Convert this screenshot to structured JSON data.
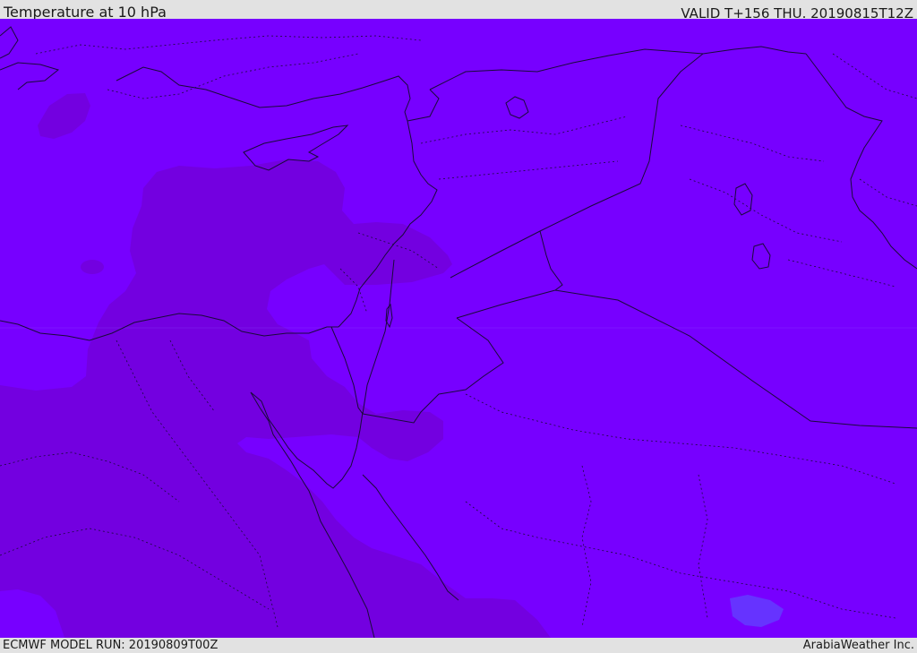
{
  "header": {
    "title": "Temperature at 10 hPa",
    "valid_time": "VALID T+156 THU. 20190815T12Z"
  },
  "footer": {
    "model_run": "ECMWF MODEL RUN: 20190809T00Z",
    "credit": "ArabiaWeather Inc."
  },
  "map": {
    "colors": {
      "base_field": "#7700ff",
      "warmer_field": "#7300e0",
      "cold_spot": "#6633ff",
      "borders": "#1a0a3a"
    }
  }
}
